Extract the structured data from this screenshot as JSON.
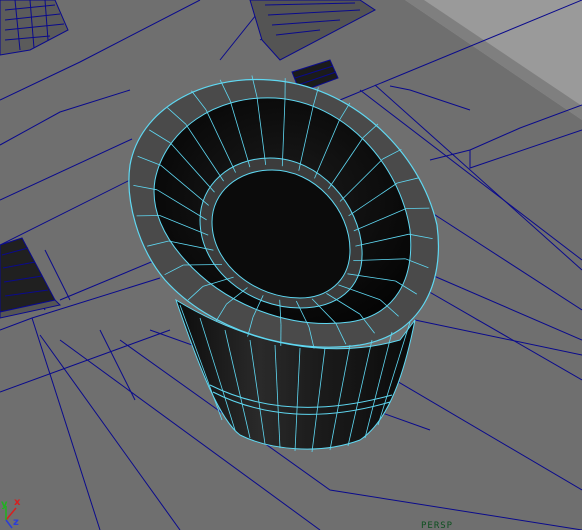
{
  "viewport": {
    "camera_label": "PERSP",
    "background_color": "#6f6f6f",
    "wireframe_color": "#0a0a8c",
    "selected_wire_color": "#5fd8f2",
    "object_shading_color": "#151515"
  },
  "axis_gizmo": {
    "x_label": "x",
    "y_label": "y",
    "z_label": "z",
    "x_color": "#d62020",
    "y_color": "#1fb31f",
    "z_color": "#2b3ed8"
  }
}
